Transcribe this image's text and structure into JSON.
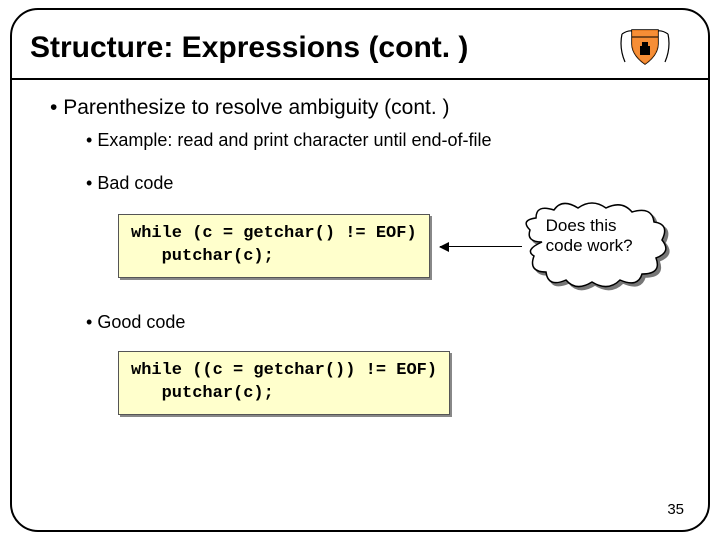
{
  "title": "Structure:  Expressions (cont. )",
  "logo_alt": "university-shield",
  "bullets": {
    "l1": "Parenthesize to resolve ambiguity (cont. )",
    "l2_example": "Example: read and print character until end-of-file",
    "l2_bad": "Bad code",
    "l2_good": "Good code"
  },
  "code_bad": "while (c = getchar() != EOF)\n   putchar(c);",
  "code_good": "while ((c = getchar()) != EOF)\n   putchar(c);",
  "callout": "Does this code work?",
  "page_number": "35",
  "colors": {
    "code_bg": "#FFFFCC",
    "border": "#000000"
  }
}
